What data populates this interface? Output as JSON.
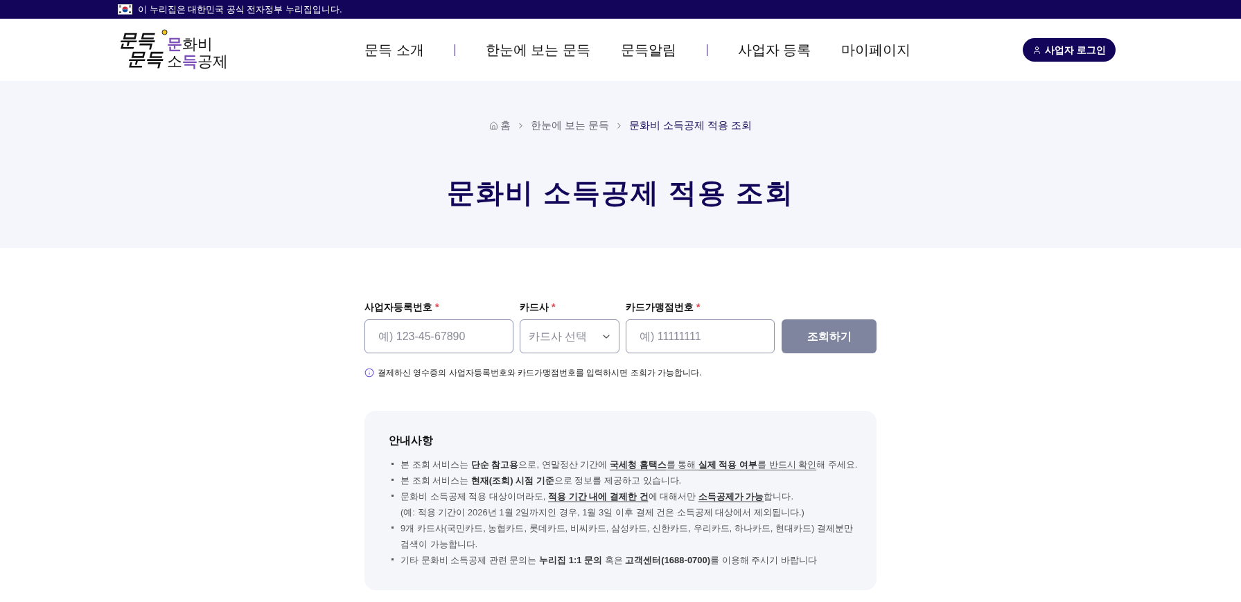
{
  "gov_banner": {
    "text": "이 누리집은 대한민국 공식 전자정부 누리집입니다."
  },
  "header": {
    "logo": {
      "script_lines": [
        "문득",
        "문득"
      ],
      "lines": [
        [
          {
            "text": "문",
            "accent": true
          },
          {
            "text": "화비",
            "accent": false
          }
        ],
        [
          {
            "text": "소",
            "accent": false
          },
          {
            "text": "득",
            "accent": true
          },
          {
            "text": "공제",
            "accent": false
          }
        ]
      ]
    },
    "nav": [
      {
        "kind": "link",
        "label": "문득 소개"
      },
      {
        "kind": "divider"
      },
      {
        "kind": "link",
        "label": "한눈에 보는 문득"
      },
      {
        "kind": "link",
        "label": "문득알림"
      },
      {
        "kind": "divider"
      },
      {
        "kind": "link",
        "label": "사업자 등록"
      },
      {
        "kind": "link",
        "label": "마이페이지"
      }
    ],
    "login_button": {
      "label": "사업자 로그인"
    }
  },
  "hero": {
    "breadcrumb": [
      {
        "label": "홈",
        "kind": "home"
      },
      {
        "label": "한눈에 보는 문득",
        "kind": "link"
      },
      {
        "label": "문화비 소득공제 적용 조회",
        "kind": "current"
      }
    ],
    "title": "문화비 소득공제 적용 조회"
  },
  "form": {
    "fields": [
      {
        "label": "사업자등록번호",
        "required_mark": "*",
        "kind": "input",
        "placeholder": "예) 123-45-67890"
      },
      {
        "label": "카드사",
        "required_mark": "*",
        "kind": "select",
        "placeholder": "카드사 선택"
      },
      {
        "label": "카드가맹점번호",
        "required_mark": "*",
        "kind": "input",
        "placeholder": "예) 11111111"
      }
    ],
    "submit_button": {
      "label": "조회하기",
      "disabled": true
    },
    "hint": "결제하신 영수증의 사업자등록번호와 카드가맹점번호를 입력하시면 조회가 가능합니다."
  },
  "notice": {
    "title": "안내사항",
    "items": [
      {
        "segments": [
          {
            "text": "본 조회 서비스는 ",
            "bold": false,
            "underline": false
          },
          {
            "text": "단순 참고용",
            "bold": true,
            "underline": false
          },
          {
            "text": "으로, 연말정산 기간에 ",
            "bold": false,
            "underline": false
          },
          {
            "text": "국세청 홈택스",
            "bold": true,
            "underline": true
          },
          {
            "text": "를 통해 ",
            "bold": false,
            "underline": true
          },
          {
            "text": "실제 적용 여부",
            "bold": true,
            "underline": true
          },
          {
            "text": "를 반드시 확인",
            "bold": false,
            "underline": true
          },
          {
            "text": "해 주세요.",
            "bold": false,
            "underline": false
          }
        ]
      },
      {
        "segments": [
          {
            "text": "본 조회 서비스는 ",
            "bold": false,
            "underline": false
          },
          {
            "text": "현재(조회) 시점 기준",
            "bold": true,
            "underline": false
          },
          {
            "text": "으로 정보를 제공하고 있습니다.",
            "bold": false,
            "underline": false
          }
        ]
      },
      {
        "segments": [
          {
            "text": "문화비 소득공제 적용 대상이더라도, ",
            "bold": false,
            "underline": false
          },
          {
            "text": "적용 기간 내에 결제한 건",
            "bold": true,
            "underline": true
          },
          {
            "text": "에 대해서만 ",
            "bold": false,
            "underline": false
          },
          {
            "text": "소득공제가 가능",
            "bold": true,
            "underline": true
          },
          {
            "text": "합니다.",
            "bold": false,
            "underline": false
          }
        ],
        "note": "(예: 적용 기간이 2026년 1월 2일까지인 경우, 1월 3일 이후 결제 건은 소득공제 대상에서 제외됩니다.)"
      },
      {
        "segments": [
          {
            "text": "9개 카드사(국민카드, 농협카드, 롯데카드, 비씨카드, 삼성카드, 신한카드, 우리카드, 하나카드, 현대카드) 결제분만 검색이 가능합니다.",
            "bold": false,
            "underline": false
          }
        ]
      },
      {
        "segments": [
          {
            "text": "기타 문화비 소득공제 관련 문의는 ",
            "bold": false,
            "underline": false
          },
          {
            "text": "누리집 1:1 문의",
            "bold": true,
            "underline": false
          },
          {
            "text": " 혹은 ",
            "bold": false,
            "underline": false
          },
          {
            "text": "고객센터(1688-0700)",
            "bold": true,
            "underline": false
          },
          {
            "text": "를 이용해 주시기 바랍니다",
            "bold": false,
            "underline": false
          }
        ]
      }
    ]
  }
}
